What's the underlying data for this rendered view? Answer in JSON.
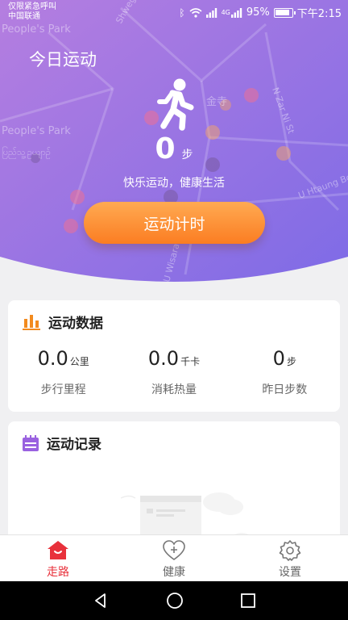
{
  "status_bar": {
    "carrier_line1": "仅限紧急呼叫",
    "carrier_line2": "中国联通",
    "network_label": "4G",
    "battery": "95%",
    "time": "下午2:15"
  },
  "map": {
    "labels": [
      "People's Park",
      "People's Park",
      "ပြည်သူ့ဥယျာဉ်",
      "Shwegon",
      "N Zar Ni St",
      "金寺",
      "U Htaung Bo",
      "U Wisara"
    ]
  },
  "hero": {
    "title": "今日运动",
    "steps": "0",
    "steps_unit": "步",
    "slogan": "快乐运动，健康生活",
    "timer_button": "运动计时"
  },
  "data_card": {
    "title": "运动数据",
    "stats": [
      {
        "value": "0.0",
        "unit": "公里",
        "label": "步行里程"
      },
      {
        "value": "0.0",
        "unit": "千卡",
        "label": "消耗热量"
      },
      {
        "value": "0",
        "unit": "步",
        "label": "昨日步数"
      }
    ]
  },
  "records_card": {
    "title": "运动记录"
  },
  "tabs": [
    {
      "label": "走路",
      "icon": "walk-home-icon",
      "active": true
    },
    {
      "label": "健康",
      "icon": "health-heart-icon",
      "active": false
    },
    {
      "label": "设置",
      "icon": "settings-gear-icon",
      "active": false
    }
  ],
  "colors": {
    "hero_gradient_start": "#b57ee0",
    "hero_gradient_end": "#7e6be6",
    "button_orange": "#fb8c2c",
    "accent_red": "#e8313b",
    "data_icon_orange": "#f28a1e",
    "records_icon_purple": "#9a62e0"
  }
}
